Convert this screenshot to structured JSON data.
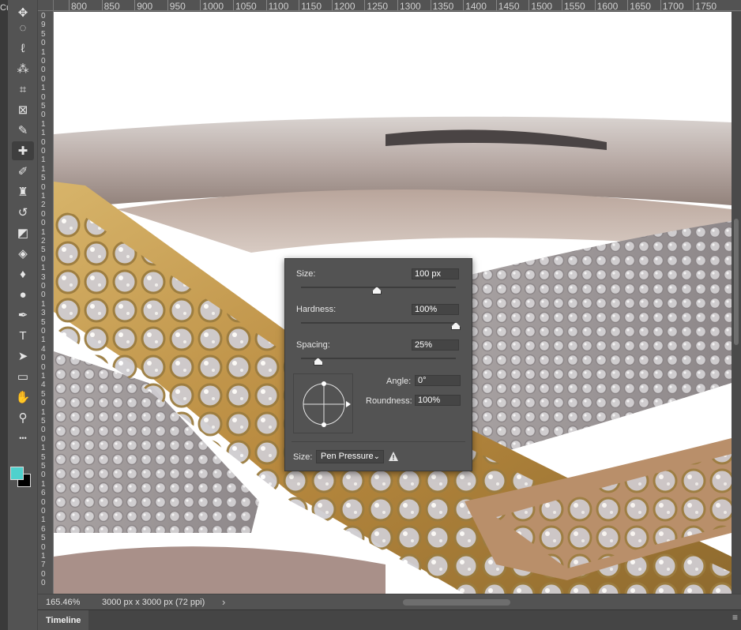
{
  "window": {
    "cut_title": "Cu"
  },
  "rulers": {
    "top_ticks": [
      "800",
      "850",
      "900",
      "950",
      "1000",
      "1050",
      "1100",
      "1150",
      "1200",
      "1250",
      "1300",
      "1350",
      "1400",
      "1450",
      "1500",
      "1550",
      "1600",
      "1650",
      "1700",
      "1750"
    ],
    "left_digits": [
      "0",
      "9",
      "5",
      "0",
      "1",
      "0",
      "0",
      "0",
      "1",
      "0",
      "5",
      "0",
      "1",
      "1",
      "0",
      "0",
      "1",
      "1",
      "5",
      "0",
      "1",
      "2",
      "0",
      "0",
      "1",
      "2",
      "5",
      "0",
      "1",
      "3",
      "0",
      "0",
      "1",
      "3",
      "5",
      "0",
      "1",
      "4",
      "0",
      "0",
      "1",
      "4",
      "5",
      "0",
      "1",
      "5",
      "0",
      "0",
      "1",
      "5",
      "5",
      "0",
      "1",
      "6",
      "0",
      "0",
      "1",
      "6",
      "5",
      "0",
      "1",
      "7",
      "0",
      "0"
    ]
  },
  "toolbar": {
    "tools": [
      {
        "name": "move-tool",
        "icon": "move-icon",
        "glyph": "✥"
      },
      {
        "name": "marquee-tool",
        "icon": "marquee-icon",
        "glyph": "◌"
      },
      {
        "name": "lasso-tool",
        "icon": "lasso-icon",
        "glyph": "ℓ"
      },
      {
        "name": "magic-wand-tool",
        "icon": "magic-wand-icon",
        "glyph": "⁂"
      },
      {
        "name": "crop-tool",
        "icon": "crop-icon",
        "glyph": "⌗"
      },
      {
        "name": "frame-tool",
        "icon": "frame-icon",
        "glyph": "⊠"
      },
      {
        "name": "eyedropper-tool",
        "icon": "eyedropper-icon",
        "glyph": "✎"
      },
      {
        "name": "healing-brush-tool",
        "icon": "bandage-icon",
        "glyph": "✚"
      },
      {
        "name": "brush-tool",
        "icon": "brush-icon",
        "glyph": "✐"
      },
      {
        "name": "clone-stamp-tool",
        "icon": "stamp-icon",
        "glyph": "♜"
      },
      {
        "name": "history-brush-tool",
        "icon": "history-brush-icon",
        "glyph": "↺"
      },
      {
        "name": "eraser-tool",
        "icon": "eraser-icon",
        "glyph": "◩"
      },
      {
        "name": "paint-bucket-tool",
        "icon": "paint-bucket-icon",
        "glyph": "◈"
      },
      {
        "name": "blur-tool",
        "icon": "blur-icon",
        "glyph": "♦"
      },
      {
        "name": "dodge-tool",
        "icon": "dodge-icon",
        "glyph": "●"
      },
      {
        "name": "pen-tool",
        "icon": "pen-icon",
        "glyph": "✒"
      },
      {
        "name": "type-tool",
        "icon": "type-icon",
        "glyph": "T"
      },
      {
        "name": "path-selection-tool",
        "icon": "arrow-icon",
        "glyph": "➤"
      },
      {
        "name": "shape-tool",
        "icon": "rectangle-icon",
        "glyph": "▭"
      },
      {
        "name": "hand-tool",
        "icon": "hand-icon",
        "glyph": "✋"
      },
      {
        "name": "zoom-tool",
        "icon": "zoom-icon",
        "glyph": "⚲"
      },
      {
        "name": "more-tools",
        "icon": "ellipsis-icon",
        "glyph": "•••"
      }
    ],
    "active_tool": "healing-brush-tool",
    "fg_color": "#4fd1cd",
    "bg_color": "#000000"
  },
  "status": {
    "zoom": "165.46%",
    "doc_info": "3000 px x 3000 px (72 ppi)",
    "arrow": "›"
  },
  "timeline": {
    "tab_label": "Timeline"
  },
  "brush_popup": {
    "size_label": "Size:",
    "size_value": "100 px",
    "size_fraction": 0.49,
    "hardness_label": "Hardness:",
    "hardness_value": "100%",
    "hardness_fraction": 1.0,
    "spacing_label": "Spacing:",
    "spacing_value": "25%",
    "spacing_fraction": 0.11,
    "angle_label": "Angle:",
    "angle_value": "0°",
    "roundness_label": "Roundness:",
    "roundness_value": "100%",
    "pressure_label": "Size:",
    "pressure_value": "Pen Pressure"
  }
}
